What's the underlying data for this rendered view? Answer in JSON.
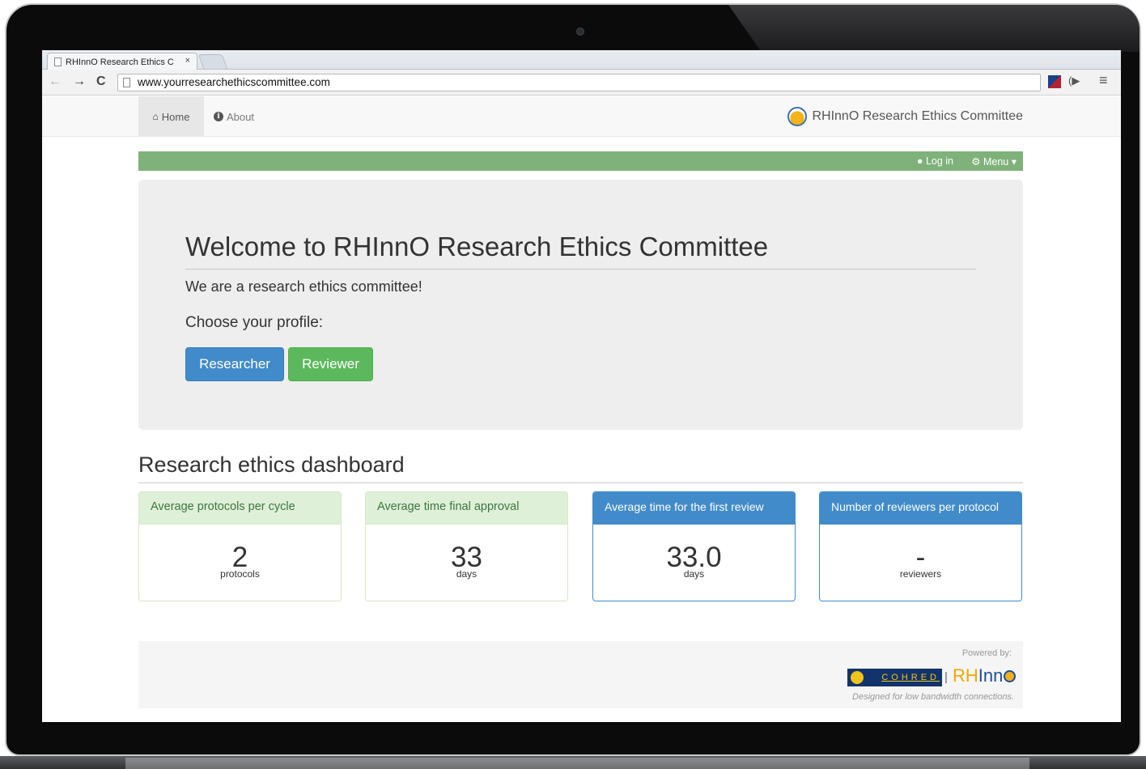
{
  "browser": {
    "tab_title": "RHInnO Research Ethics C",
    "tab_close": "×",
    "url": "www.yourresearchethicscommittee.com",
    "nav": {
      "back": "←",
      "forward": "→",
      "reload": "C"
    },
    "menu_icon": "≡",
    "audio_icon": "(▶"
  },
  "navbar": {
    "home_label": "Home",
    "about_label": "About",
    "brand": "RHInnO Research Ethics Committee"
  },
  "greenbar": {
    "login_label": "Log in",
    "menu_label": "Menu"
  },
  "jumbotron": {
    "title": "Welcome to RHInnO Research Ethics Committee",
    "intro": "We are a research ethics committee!",
    "choose": "Choose your profile:",
    "researcher_button": "Researcher",
    "reviewer_button": "Reviewer"
  },
  "dashboard": {
    "title": "Research ethics dashboard",
    "panels": [
      {
        "heading": "Average protocols per cycle",
        "value": "2",
        "unit": "protocols",
        "style": "green"
      },
      {
        "heading": "Average time final approval",
        "value": "33",
        "unit": "days",
        "style": "green"
      },
      {
        "heading": "Average time for the first review",
        "value": "33.0",
        "unit": "days",
        "style": "blue"
      },
      {
        "heading": "Number of reviewers per protocol",
        "value": "-",
        "unit": "reviewers",
        "style": "blue"
      }
    ]
  },
  "footer": {
    "powered_by": "Powered by:",
    "cohred": "COHRED",
    "separator": "|",
    "rhinno_rh": "RH",
    "rhinno_inn": "Inn",
    "designed": "Designed for low bandwidth connections."
  },
  "colors": {
    "green_bar": "#7fb27a",
    "primary": "#428bca",
    "success": "#5cb85c",
    "panel_green_bg": "#dff0d8"
  }
}
